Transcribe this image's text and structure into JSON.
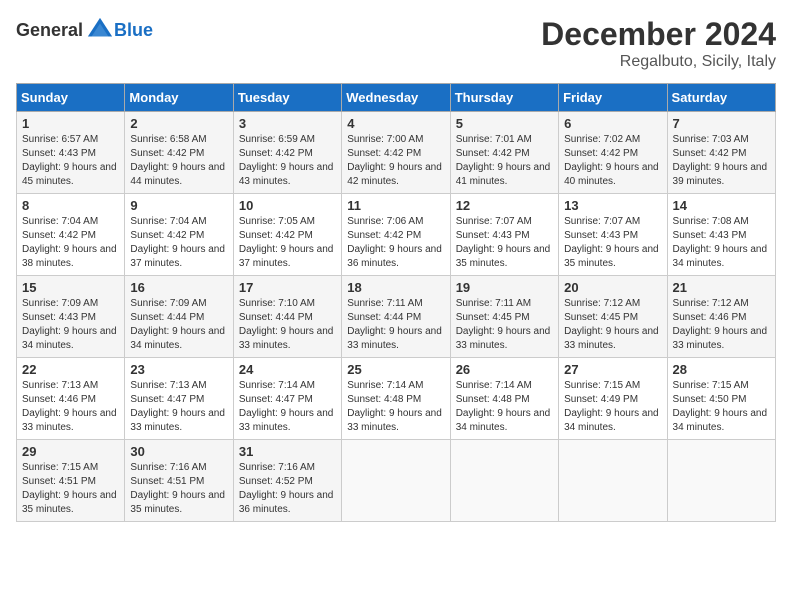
{
  "logo": {
    "general": "General",
    "blue": "Blue"
  },
  "title": "December 2024",
  "subtitle": "Regalbuto, Sicily, Italy",
  "headers": [
    "Sunday",
    "Monday",
    "Tuesday",
    "Wednesday",
    "Thursday",
    "Friday",
    "Saturday"
  ],
  "weeks": [
    [
      {
        "day": "1",
        "sunrise": "6:57 AM",
        "sunset": "4:43 PM",
        "daylight": "9 hours and 45 minutes."
      },
      {
        "day": "2",
        "sunrise": "6:58 AM",
        "sunset": "4:42 PM",
        "daylight": "9 hours and 44 minutes."
      },
      {
        "day": "3",
        "sunrise": "6:59 AM",
        "sunset": "4:42 PM",
        "daylight": "9 hours and 43 minutes."
      },
      {
        "day": "4",
        "sunrise": "7:00 AM",
        "sunset": "4:42 PM",
        "daylight": "9 hours and 42 minutes."
      },
      {
        "day": "5",
        "sunrise": "7:01 AM",
        "sunset": "4:42 PM",
        "daylight": "9 hours and 41 minutes."
      },
      {
        "day": "6",
        "sunrise": "7:02 AM",
        "sunset": "4:42 PM",
        "daylight": "9 hours and 40 minutes."
      },
      {
        "day": "7",
        "sunrise": "7:03 AM",
        "sunset": "4:42 PM",
        "daylight": "9 hours and 39 minutes."
      }
    ],
    [
      {
        "day": "8",
        "sunrise": "7:04 AM",
        "sunset": "4:42 PM",
        "daylight": "9 hours and 38 minutes."
      },
      {
        "day": "9",
        "sunrise": "7:04 AM",
        "sunset": "4:42 PM",
        "daylight": "9 hours and 37 minutes."
      },
      {
        "day": "10",
        "sunrise": "7:05 AM",
        "sunset": "4:42 PM",
        "daylight": "9 hours and 37 minutes."
      },
      {
        "day": "11",
        "sunrise": "7:06 AM",
        "sunset": "4:42 PM",
        "daylight": "9 hours and 36 minutes."
      },
      {
        "day": "12",
        "sunrise": "7:07 AM",
        "sunset": "4:43 PM",
        "daylight": "9 hours and 35 minutes."
      },
      {
        "day": "13",
        "sunrise": "7:07 AM",
        "sunset": "4:43 PM",
        "daylight": "9 hours and 35 minutes."
      },
      {
        "day": "14",
        "sunrise": "7:08 AM",
        "sunset": "4:43 PM",
        "daylight": "9 hours and 34 minutes."
      }
    ],
    [
      {
        "day": "15",
        "sunrise": "7:09 AM",
        "sunset": "4:43 PM",
        "daylight": "9 hours and 34 minutes."
      },
      {
        "day": "16",
        "sunrise": "7:09 AM",
        "sunset": "4:44 PM",
        "daylight": "9 hours and 34 minutes."
      },
      {
        "day": "17",
        "sunrise": "7:10 AM",
        "sunset": "4:44 PM",
        "daylight": "9 hours and 33 minutes."
      },
      {
        "day": "18",
        "sunrise": "7:11 AM",
        "sunset": "4:44 PM",
        "daylight": "9 hours and 33 minutes."
      },
      {
        "day": "19",
        "sunrise": "7:11 AM",
        "sunset": "4:45 PM",
        "daylight": "9 hours and 33 minutes."
      },
      {
        "day": "20",
        "sunrise": "7:12 AM",
        "sunset": "4:45 PM",
        "daylight": "9 hours and 33 minutes."
      },
      {
        "day": "21",
        "sunrise": "7:12 AM",
        "sunset": "4:46 PM",
        "daylight": "9 hours and 33 minutes."
      }
    ],
    [
      {
        "day": "22",
        "sunrise": "7:13 AM",
        "sunset": "4:46 PM",
        "daylight": "9 hours and 33 minutes."
      },
      {
        "day": "23",
        "sunrise": "7:13 AM",
        "sunset": "4:47 PM",
        "daylight": "9 hours and 33 minutes."
      },
      {
        "day": "24",
        "sunrise": "7:14 AM",
        "sunset": "4:47 PM",
        "daylight": "9 hours and 33 minutes."
      },
      {
        "day": "25",
        "sunrise": "7:14 AM",
        "sunset": "4:48 PM",
        "daylight": "9 hours and 33 minutes."
      },
      {
        "day": "26",
        "sunrise": "7:14 AM",
        "sunset": "4:48 PM",
        "daylight": "9 hours and 34 minutes."
      },
      {
        "day": "27",
        "sunrise": "7:15 AM",
        "sunset": "4:49 PM",
        "daylight": "9 hours and 34 minutes."
      },
      {
        "day": "28",
        "sunrise": "7:15 AM",
        "sunset": "4:50 PM",
        "daylight": "9 hours and 34 minutes."
      }
    ],
    [
      {
        "day": "29",
        "sunrise": "7:15 AM",
        "sunset": "4:51 PM",
        "daylight": "9 hours and 35 minutes."
      },
      {
        "day": "30",
        "sunrise": "7:16 AM",
        "sunset": "4:51 PM",
        "daylight": "9 hours and 35 minutes."
      },
      {
        "day": "31",
        "sunrise": "7:16 AM",
        "sunset": "4:52 PM",
        "daylight": "9 hours and 36 minutes."
      },
      null,
      null,
      null,
      null
    ]
  ]
}
